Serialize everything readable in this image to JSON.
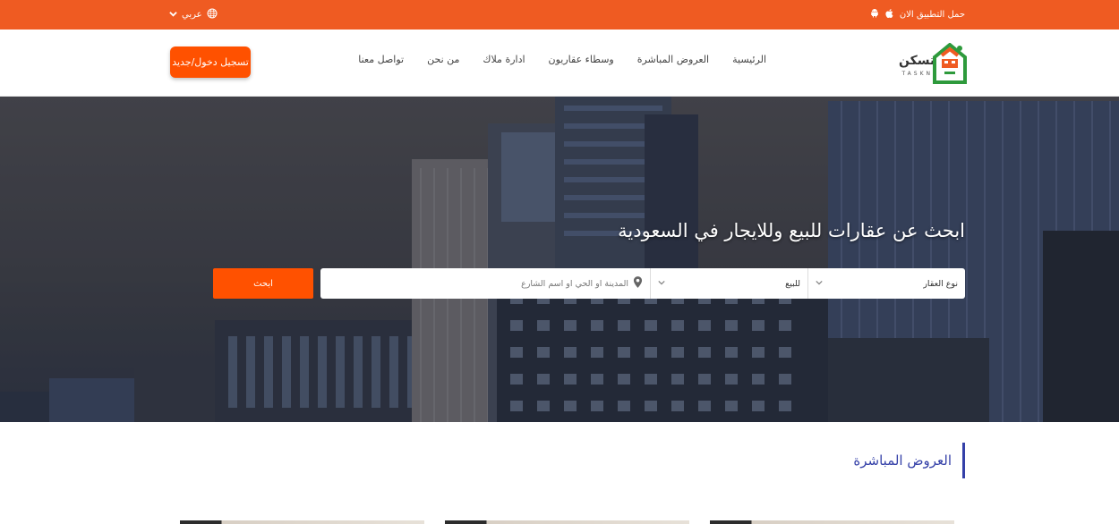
{
  "topbar": {
    "app_download_label": "حمل التطبيق الان",
    "language_label": "عربي",
    "icons": [
      "android-icon",
      "apple-icon",
      "globe-icon",
      "chevron-down-icon"
    ]
  },
  "brand": {
    "logo_text": "تسكن",
    "logo_subtext": "TASKN",
    "colors": {
      "orange": "#ef5b22",
      "button": "#ff5100",
      "green": "#2e9a3c",
      "blue": "#3440a8"
    }
  },
  "nav": {
    "items": [
      {
        "label": "الرئيسية"
      },
      {
        "label": "العروض المباشرة"
      },
      {
        "label": "وسطاء عقاريون"
      },
      {
        "label": "ادارة ملاك"
      },
      {
        "label": "من نحن"
      },
      {
        "label": "تواصل معنا"
      }
    ],
    "login_label": "تسجيل دخول/جديد"
  },
  "hero": {
    "title": "ابحث عن عقارات للبيع وللايجار في السعودية",
    "search": {
      "property_type_value": "نوع العقار",
      "purpose_value": "للبيع",
      "location_placeholder": "المدينة او الحي او اسم الشارع",
      "button_label": "ابحث"
    }
  },
  "section": {
    "title": "العروض المباشرة"
  }
}
